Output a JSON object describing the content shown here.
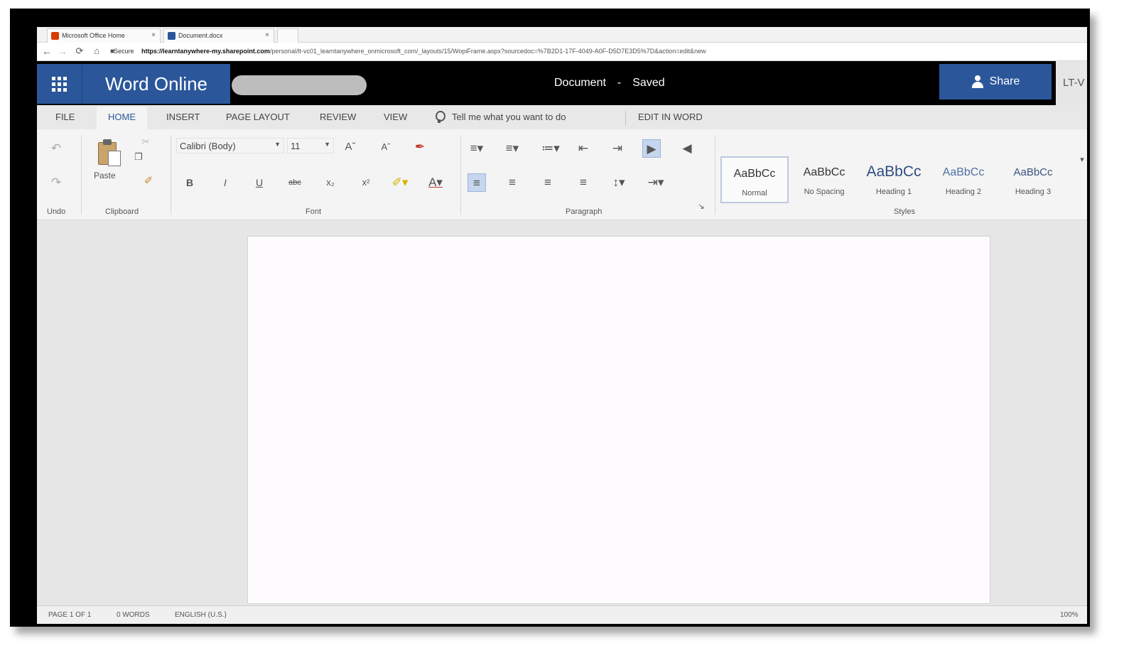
{
  "browser": {
    "tabs": [
      {
        "title": "Microsoft Office Home",
        "close": "×"
      },
      {
        "title": "Document.docx",
        "close": "×"
      }
    ],
    "secure_label": "Secure",
    "url_host": "https://learntanywhere-my.sharepoint.com",
    "url_path": "/personal/lt-vc01_learntanywhere_onmicrosoft_com/_layouts/15/WopiFrame.aspx?sourcedoc=%7B2D1-17F-4049-A0F-D5D7E3D5%7D&action=edit&new"
  },
  "app": {
    "brand": "Word Online",
    "document_name": "Document",
    "separator": "-",
    "save_status": "Saved",
    "share_label": "Share",
    "user_label": "LT-V"
  },
  "ribbon_tabs": {
    "file": "FILE",
    "home": "HOME",
    "insert": "INSERT",
    "page_layout": "PAGE LAYOUT",
    "review": "REVIEW",
    "view": "VIEW",
    "tell_me": "Tell me what you want to do",
    "edit_in_word": "EDIT IN WORD"
  },
  "ribbon": {
    "groups": {
      "undo": "Undo",
      "clipboard": "Clipboard",
      "font": "Font",
      "paragraph": "Paragraph",
      "styles": "Styles"
    },
    "paste_label": "Paste",
    "font_name": "Calibri (Body)",
    "font_size": "11",
    "styles": [
      {
        "sample": "AaBbCc",
        "name": "Normal"
      },
      {
        "sample": "AaBbCc",
        "name": "No Spacing"
      },
      {
        "sample": "AaBbCc",
        "name": "Heading 1"
      },
      {
        "sample": "AaBbCc",
        "name": "Heading 2"
      },
      {
        "sample": "AaBbCc",
        "name": "Heading 3"
      }
    ]
  },
  "status": {
    "page": "PAGE 1 OF 1",
    "words": "0 WORDS",
    "language": "ENGLISH (U.S.)",
    "zoom": "100%"
  },
  "colors": {
    "accent": "#2b579a",
    "header": "#000000"
  }
}
